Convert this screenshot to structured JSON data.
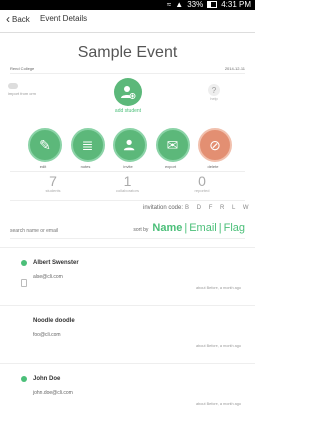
{
  "status_bar": {
    "time": "4:31 PM",
    "battery": "33%"
  },
  "header": {
    "back_label": "Back",
    "title": "Event Details"
  },
  "event": {
    "title": "Sample Event",
    "organizer": "Rend College",
    "date": "2014-12-11"
  },
  "ghost_left": {
    "label": "import from crm"
  },
  "add_student": {
    "label": "add student"
  },
  "ghost_right": {
    "label": "help"
  },
  "actions": [
    {
      "label": "edit",
      "icon": "pencil-icon"
    },
    {
      "label": "notes",
      "icon": "notes-icon"
    },
    {
      "label": "invite",
      "icon": "user-add-icon"
    },
    {
      "label": "export",
      "icon": "email-icon"
    },
    {
      "label": "delete",
      "icon": "ban-icon"
    }
  ],
  "stats": [
    {
      "value": "7",
      "label": "students"
    },
    {
      "value": "1",
      "label": "collaborators"
    },
    {
      "value": "0",
      "label": "reported"
    }
  ],
  "invite": {
    "label": "invitation code:",
    "code": "B D F R L W"
  },
  "search": {
    "placeholder": "search name or email"
  },
  "sort": {
    "label": "sort by",
    "options": [
      "Name",
      "Email",
      "Flag"
    ],
    "active": "Name"
  },
  "students": [
    {
      "name": "Albert Swenster",
      "email": "alse@cli.com",
      "time": "about Before, a month ago",
      "flag": true
    },
    {
      "name": "Noodle doodle",
      "email": "foo@cli.com",
      "time": "about Before, a month ago",
      "flag": false
    },
    {
      "name": "John Doe",
      "email": "john.doe@cli.com",
      "time": "about Before, a month ago",
      "flag": true
    }
  ],
  "colors": {
    "accent": "#4bbf79",
    "delete": "#e38f72"
  }
}
